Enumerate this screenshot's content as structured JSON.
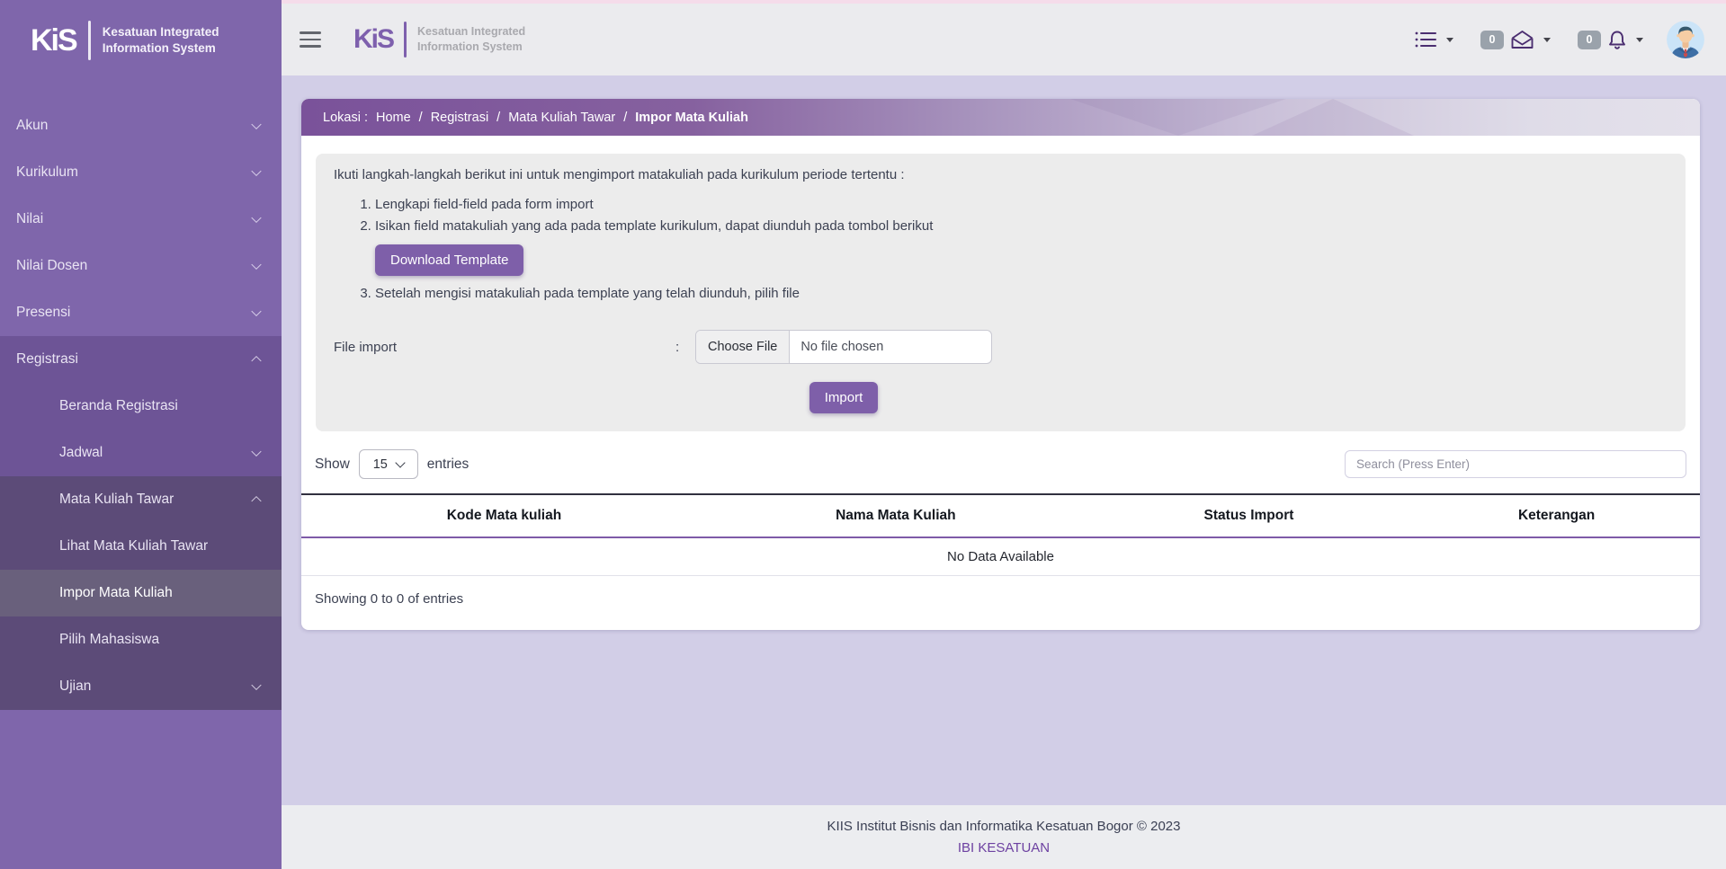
{
  "app": {
    "logo_text": "KiS",
    "brand_line1": "Kesatuan Integrated",
    "brand_line2": "Information System"
  },
  "colors": {
    "sidebar_purple": "#7f66ab",
    "sidebar_group": "#6d5496",
    "sidebar_subgroup": "#5c4b78",
    "sidebar_active": "#69607c",
    "accent_button": "#7e5fa9",
    "breadcrumb_start": "#7a529a",
    "topbar_pink_line": "#f5dcea",
    "badge_gray": "#9aa2ab",
    "table_header_border": "#7e5aa8",
    "footer_link": "#6d41a1"
  },
  "sidebar": {
    "items": [
      {
        "label": "Akun",
        "chevron": "down"
      },
      {
        "label": "Kurikulum",
        "chevron": "down"
      },
      {
        "label": "Nilai",
        "chevron": "down"
      },
      {
        "label": "Nilai Dosen",
        "chevron": "down"
      },
      {
        "label": "Presensi",
        "chevron": "down"
      },
      {
        "label": "Registrasi",
        "chevron": "up"
      },
      {
        "label": "Beranda Registrasi",
        "chevron": "none"
      },
      {
        "label": "Jadwal",
        "chevron": "down"
      },
      {
        "label": "Mata Kuliah Tawar",
        "chevron": "up"
      },
      {
        "label": "Lihat Mata Kuliah Tawar",
        "chevron": "none"
      },
      {
        "label": "Impor Mata Kuliah",
        "chevron": "none",
        "active": true
      },
      {
        "label": "Pilih Mahasiswa",
        "chevron": "none"
      },
      {
        "label": "Ujian",
        "chevron": "down"
      }
    ]
  },
  "topbar": {
    "mail_badge": "0",
    "bell_badge": "0",
    "icons": [
      "hamburger-icon",
      "task-list-icon",
      "mail-open-icon",
      "bell-icon",
      "user-avatar"
    ]
  },
  "breadcrumb": {
    "prefix": "Lokasi :",
    "separator": "/",
    "items": [
      {
        "label": "Home"
      },
      {
        "label": "Registrasi"
      },
      {
        "label": "Mata Kuliah Tawar"
      },
      {
        "label": "Impor Mata Kuliah"
      }
    ]
  },
  "import_panel": {
    "intro": "Ikuti langkah-langkah berikut ini untuk mengimport matakuliah pada kurikulum periode tertentu :",
    "steps": [
      "Lengkapi field-field pada form import",
      "Isikan field matakuliah yang ada pada template kurikulum, dapat diunduh pada tombol berikut",
      "Setelah mengisi matakuliah pada template yang telah diunduh, pilih file"
    ],
    "download_button": "Download Template",
    "file_label": "File import",
    "colon": ":",
    "choose_file_button": "Choose File",
    "file_status": "No file chosen",
    "import_button": "Import"
  },
  "table_controls": {
    "show_label": "Show",
    "page_size": "15",
    "entries_label": "entries",
    "search_placeholder": "Search (Press Enter)"
  },
  "table": {
    "headers": [
      "Kode Mata kuliah",
      "Nama Mata Kuliah",
      "Status Import",
      "Keterangan"
    ],
    "empty_text": "No Data Available",
    "summary": "Showing 0 to 0 of entries"
  },
  "footer": {
    "line1": "KIIS Institut Bisnis dan Informatika Kesatuan Bogor © 2023",
    "link": "IBI KESATUAN"
  }
}
